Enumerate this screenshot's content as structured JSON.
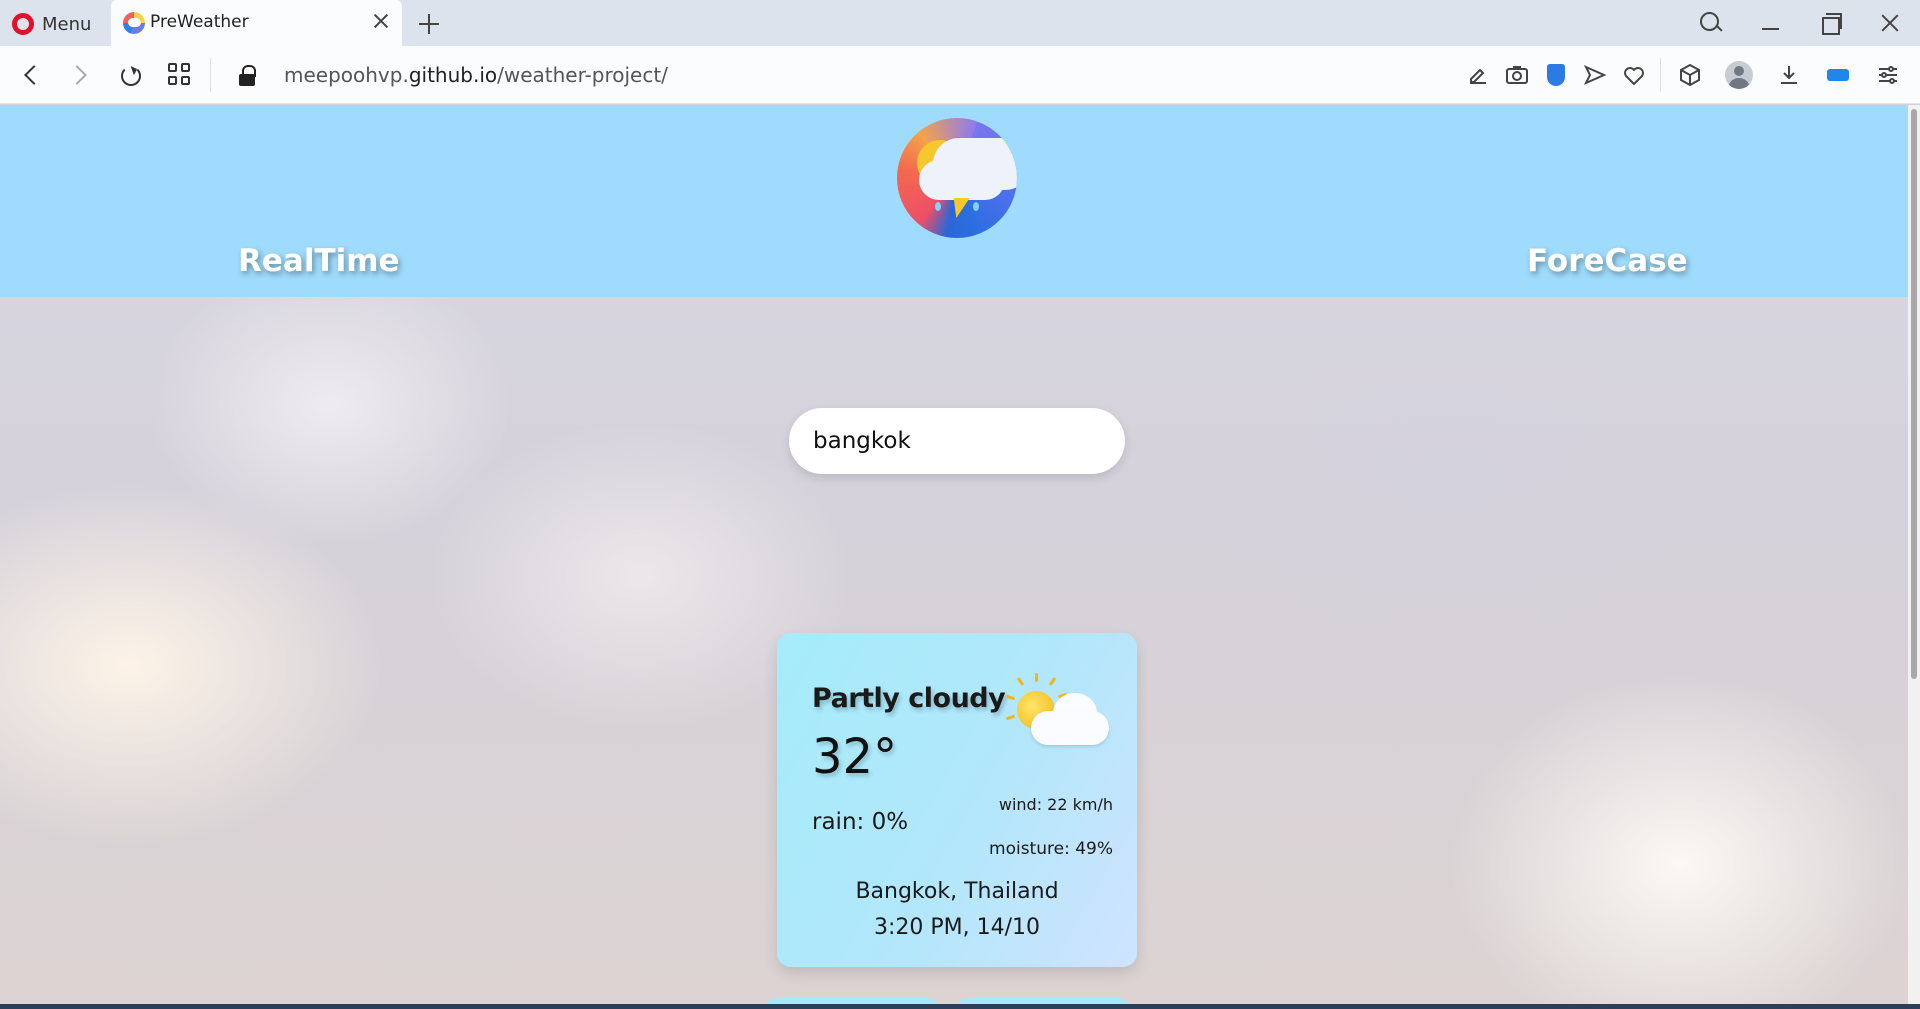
{
  "browser": {
    "menu_label": "Menu",
    "tab_title": "PreWeather",
    "url_prefix": "meepoohvp.",
    "url_host": "github.io",
    "url_path": "/weather-project/"
  },
  "header": {
    "nav_left": "RealTime",
    "nav_right": "ForeCase",
    "background": "#9fdbfc"
  },
  "search": {
    "value": "bangkok"
  },
  "weather_card": {
    "condition": "Partly cloudy",
    "condition_icon": "partly-cloudy-icon",
    "temperature": "32°",
    "rain": "rain: 0%",
    "wind": "wind: 22 km/h",
    "moisture": "moisture: 49%",
    "location": "Bangkok, Thailand",
    "datetime": "3:20 PM, 14/10"
  },
  "colors": {
    "card_gradient_start": "#a5ecfa",
    "card_gradient_end": "#cfe3fd",
    "opera_red": "#e0112b",
    "accent_blue": "#2c7be5"
  }
}
